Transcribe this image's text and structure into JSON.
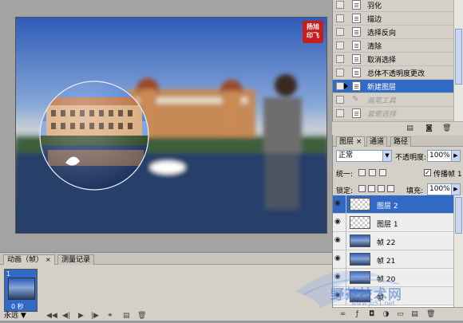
{
  "canvas": {
    "stamp_text": [
      "扬旭",
      "印飞"
    ]
  },
  "history": {
    "items": [
      {
        "label": "羽化",
        "type": "doc",
        "state": "normal"
      },
      {
        "label": "描边",
        "type": "doc",
        "state": "normal"
      },
      {
        "label": "选择反向",
        "type": "doc",
        "state": "normal"
      },
      {
        "label": "清除",
        "type": "doc",
        "state": "normal"
      },
      {
        "label": "取消选择",
        "type": "doc",
        "state": "normal"
      },
      {
        "label": "总体不透明度更改",
        "type": "doc",
        "state": "normal"
      },
      {
        "label": "新建图层",
        "type": "doc",
        "state": "selected"
      },
      {
        "label": "画笔工具",
        "type": "brush",
        "state": "dimmed"
      },
      {
        "label": "套索选择",
        "type": "doc",
        "state": "dimmed"
      },
      {
        "label": "清除",
        "type": "brush",
        "state": "dimmed"
      }
    ]
  },
  "layers": {
    "tabs": [
      {
        "label": "图层",
        "close": "×"
      },
      {
        "label": "通道"
      },
      {
        "label": "路径"
      }
    ],
    "blend_mode": "正常",
    "opacity_label": "不透明度:",
    "opacity_value": "100%",
    "unify_label": "统一:",
    "propagate_label": "传播帧 1",
    "lock_label": "锁定:",
    "fill_label": "填充:",
    "fill_value": "100%",
    "items": [
      {
        "name": "图层 2",
        "thumb": "transparent",
        "selected": true
      },
      {
        "name": "图层 1",
        "thumb": "transparent",
        "selected": false
      },
      {
        "name": "帧 22",
        "thumb": "frame",
        "selected": false
      },
      {
        "name": "帧 21",
        "thumb": "frame",
        "selected": false
      },
      {
        "name": "帧 20",
        "thumb": "frame",
        "selected": false
      },
      {
        "name": "帧",
        "thumb": "frame",
        "selected": false
      }
    ]
  },
  "animation": {
    "tabs": [
      {
        "label": "动画（帧）",
        "close": "×"
      },
      {
        "label": "测量记录"
      }
    ],
    "frame_number": "1",
    "frame_delay": "0 秒",
    "loop_option": "永远"
  },
  "watermark": {
    "text": "野茶技术网",
    "url": "www.jb51.net"
  }
}
